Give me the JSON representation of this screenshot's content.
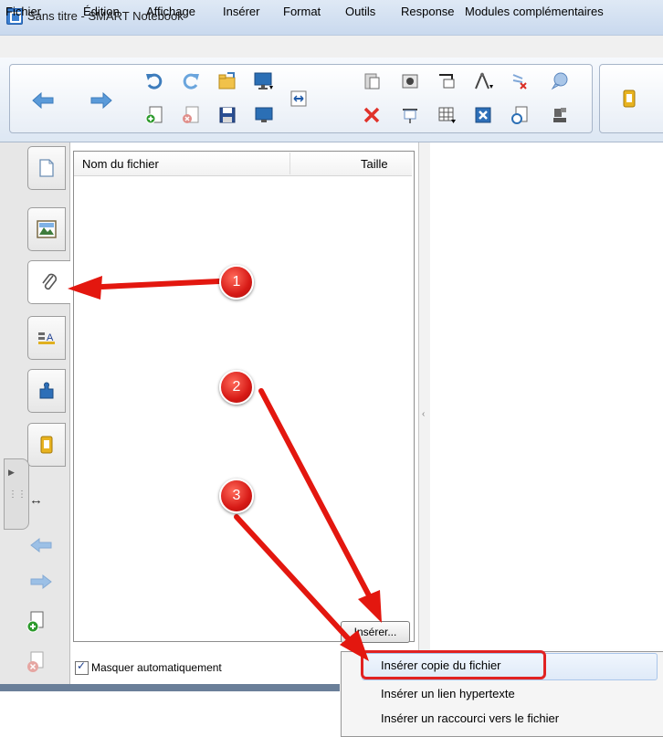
{
  "window": {
    "title": "Sans titre - SMART Notebook"
  },
  "menu": {
    "items": [
      "Fichier",
      "Édition",
      "Affichage",
      "Insérer",
      "Format",
      "Outils",
      "Response",
      "Modules complémentaires"
    ]
  },
  "toolbar": {
    "back_icon": "arrow-left-icon",
    "forward_icon": "arrow-right-icon"
  },
  "side_tabs": [
    {
      "name": "page-sorter-icon"
    },
    {
      "name": "gallery-icon"
    },
    {
      "name": "attachments-icon",
      "active": true
    },
    {
      "name": "properties-icon"
    },
    {
      "name": "add-ons-icon"
    },
    {
      "name": "response-icon"
    }
  ],
  "attachments": {
    "column_name": "Nom du fichier",
    "column_size": "Taille",
    "rows": [],
    "insert_button": "Insérer...",
    "autohide_label": "Masquer automatiquement",
    "autohide_checked": true
  },
  "insert_menu": {
    "items": [
      "Insérer copie du fichier",
      "Insérer un lien hypertexte",
      "Insérer un raccourci vers le fichier"
    ],
    "highlighted_index": 0
  },
  "callouts": [
    "1",
    "2",
    "3"
  ],
  "colors": {
    "callout_red": "#e12222",
    "toolbar_blue": "#3b7fd0",
    "title_bar": "#dfe9f5"
  }
}
